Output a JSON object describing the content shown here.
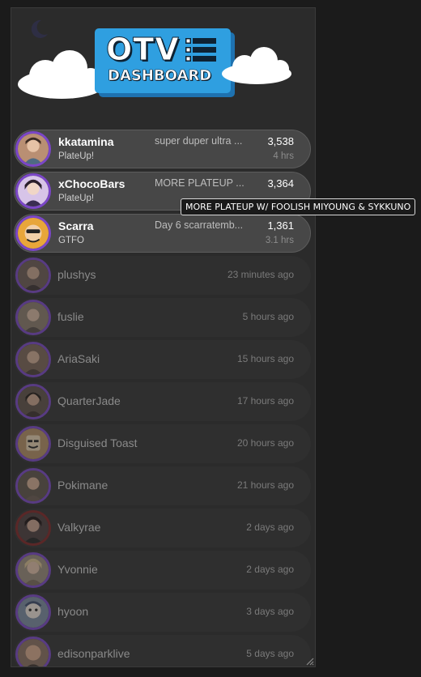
{
  "header": {
    "logo_line1": "OTV",
    "logo_line2": "DASHBOARD"
  },
  "live": [
    {
      "name": "kkatamina",
      "game": "PlateUp!",
      "title": "super duper ultra ...",
      "viewers": "3,538",
      "uptime": "4 hrs"
    },
    {
      "name": "xChocoBars",
      "game": "PlateUp!",
      "title": "MORE PLATEUP ...",
      "viewers": "3,364",
      "uptime": ""
    },
    {
      "name": "Scarra",
      "game": "GTFO",
      "title": "Day 6 scarratemb...",
      "viewers": "1,361",
      "uptime": "3.1 hrs"
    }
  ],
  "offline": [
    {
      "name": "plushys",
      "ago": "23 minutes ago"
    },
    {
      "name": "fuslie",
      "ago": "5 hours ago"
    },
    {
      "name": "AriaSaki",
      "ago": "15 hours ago"
    },
    {
      "name": "QuarterJade",
      "ago": "17 hours ago"
    },
    {
      "name": "Disguised Toast",
      "ago": "20 hours ago"
    },
    {
      "name": "Pokimane",
      "ago": "21 hours ago"
    },
    {
      "name": "Valkyrae",
      "ago": "2 days ago"
    },
    {
      "name": "Yvonnie",
      "ago": "2 days ago"
    },
    {
      "name": "hyoon",
      "ago": "3 days ago"
    },
    {
      "name": "edisonparklive",
      "ago": "5 days ago"
    }
  ],
  "tooltip": "MORE PLATEUP W/ FOOLISH MIYOUNG & SYKKUNO",
  "colors": {
    "accent_purple": "#7b46c8",
    "accent_red": "#7e2121",
    "logo_blue": "#2f9fe0"
  }
}
